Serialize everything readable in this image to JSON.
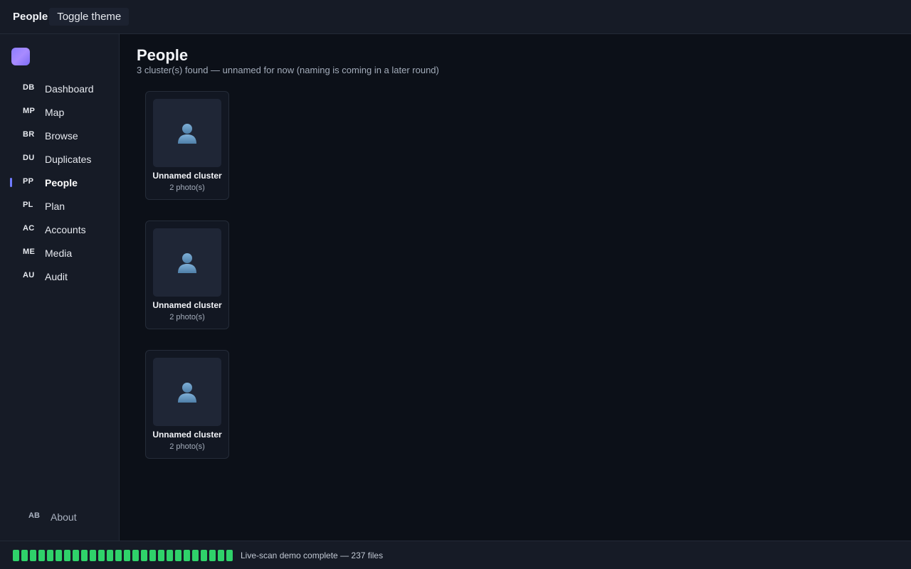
{
  "header": {
    "title": "People",
    "toggle_label": "Toggle theme"
  },
  "sidebar": {
    "items": [
      {
        "abbr": "DB",
        "label": "Dashboard",
        "active": false
      },
      {
        "abbr": "MP",
        "label": "Map",
        "active": false
      },
      {
        "abbr": "BR",
        "label": "Browse",
        "active": false
      },
      {
        "abbr": "DU",
        "label": "Duplicates",
        "active": false
      },
      {
        "abbr": "PP",
        "label": "People",
        "active": true
      },
      {
        "abbr": "PL",
        "label": "Plan",
        "active": false
      },
      {
        "abbr": "AC",
        "label": "Accounts",
        "active": false
      },
      {
        "abbr": "ME",
        "label": "Media",
        "active": false
      },
      {
        "abbr": "AU",
        "label": "Audit",
        "active": false
      }
    ],
    "about": {
      "abbr": "AB",
      "label": "About"
    }
  },
  "main": {
    "title": "People",
    "subtitle": "3 cluster(s) found — unnamed for now (naming is coming in a later round)",
    "clusters": [
      {
        "name": "Unnamed cluster",
        "count": "2 photo(s)",
        "icon": "person-silhouette-icon"
      },
      {
        "name": "Unnamed cluster",
        "count": "2 photo(s)",
        "icon": "person-silhouette-icon"
      },
      {
        "name": "Unnamed cluster",
        "count": "2 photo(s)",
        "icon": "person-silhouette-icon"
      }
    ]
  },
  "status": {
    "progress": 1.0,
    "text": "Live-scan demo complete — 237 files"
  },
  "colors": {
    "accent": "#6f7bff",
    "progress": "#2fd26a",
    "logo": "#8c7dff"
  }
}
